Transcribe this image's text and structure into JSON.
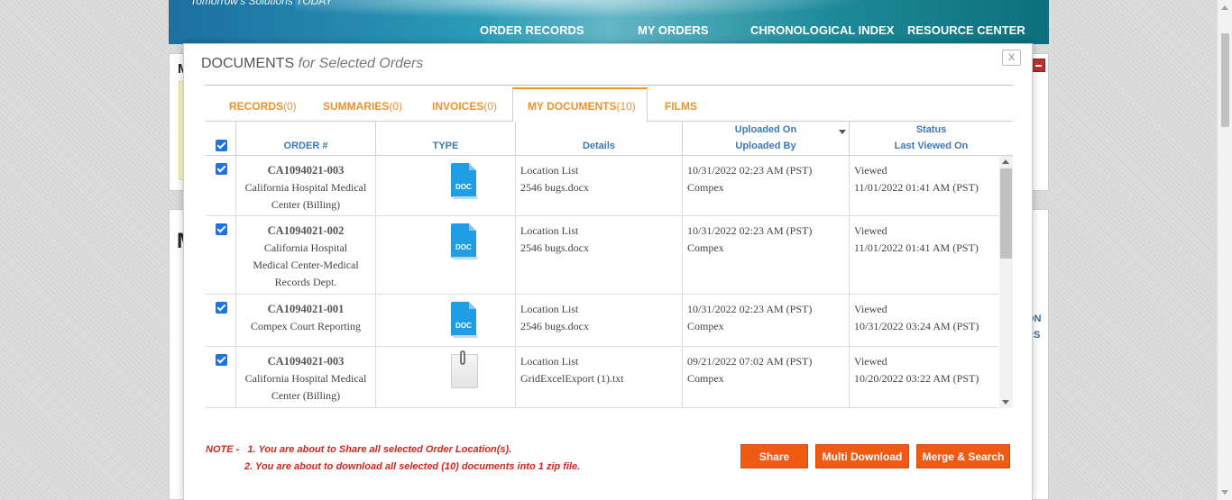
{
  "header": {
    "tagline": "Tomorrow's Solutions TODAY",
    "nav": [
      "ORDER RECORDS",
      "MY ORDERS",
      "CHRONOLOGICAL INDEX",
      "RESOURCE CENTER"
    ]
  },
  "background": {
    "panel1_letter": "M",
    "panel2_letter": "M",
    "right_labels": [
      "ON",
      "RS"
    ]
  },
  "modal": {
    "title": "DOCUMENTS",
    "subtitle": "for Selected Orders",
    "close_label": "X",
    "tabs": [
      {
        "label": "RECORDS",
        "count": "(0)"
      },
      {
        "label": "SUMMARIES",
        "count": "(0)"
      },
      {
        "label": "INVOICES",
        "count": "(0)"
      },
      {
        "label": "MY DOCUMENTS",
        "count": "(10)",
        "active": true
      },
      {
        "label": "FILMS",
        "count": ""
      }
    ],
    "columns": {
      "order": "ORDER #",
      "type": "TYPE",
      "details": "Details",
      "uploaded_on": "Uploaded On",
      "uploaded_by": "Uploaded By",
      "status": "Status",
      "last_viewed": "Last Viewed On"
    },
    "rows": [
      {
        "checked": true,
        "order_number": "CA1094021-003",
        "facility": "California Hospital Medical Center (Billing)",
        "file_type": "doc",
        "detail_title": "Location List",
        "file_name": "2546 bugs.docx",
        "uploaded_on": "10/31/2022 02:23 AM (PST)",
        "uploaded_by": "Compex",
        "status": "Viewed",
        "last_viewed": "11/01/2022 01:41 AM (PST)"
      },
      {
        "checked": true,
        "order_number": "CA1094021-002",
        "facility": "California Hospital Medical Center-Medical Records Dept.",
        "file_type": "doc",
        "detail_title": "Location List",
        "file_name": "2546 bugs.docx",
        "uploaded_on": "10/31/2022 02:23 AM (PST)",
        "uploaded_by": "Compex",
        "status": "Viewed",
        "last_viewed": "11/01/2022 01:41 AM (PST)"
      },
      {
        "checked": true,
        "order_number": "CA1094021-001",
        "facility": "Compex Court Reporting",
        "file_type": "doc",
        "detail_title": "Location List",
        "file_name": "2546 bugs.docx",
        "uploaded_on": "10/31/2022 02:23 AM (PST)",
        "uploaded_by": "Compex",
        "status": "Viewed",
        "last_viewed": "10/31/2022 03:24 AM (PST)"
      },
      {
        "checked": true,
        "order_number": "CA1094021-003",
        "facility": "California Hospital Medical Center (Billing)",
        "file_type": "txt",
        "detail_title": "Location List",
        "file_name": "GridExcelExport (1).txt",
        "uploaded_on": "09/21/2022 07:02 AM (PST)",
        "uploaded_by": "Compex",
        "status": "Viewed",
        "last_viewed": "10/20/2022 03:22 AM (PST)"
      }
    ],
    "note": {
      "prefix": "NOTE -",
      "line1": "1. You are about to Share all selected Order Location(s).",
      "line2": "2. You are about to download all selected (10) documents into 1 zip file."
    },
    "buttons": {
      "share": "Share",
      "multi_download": "Multi Download",
      "merge_search": "Merge & Search"
    },
    "colors": {
      "accent_orange": "#f05a13",
      "tab_orange": "#f0922f",
      "header_blue": "#3d79b3",
      "note_red": "#d9241c",
      "checkbox_blue": "#1a73e8"
    }
  }
}
